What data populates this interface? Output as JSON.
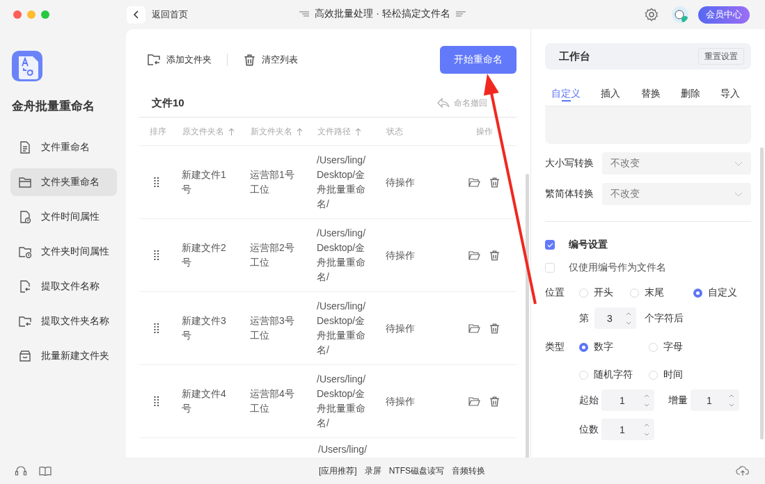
{
  "window": {
    "back_label": "返回首页",
    "title": "高效批量处理 · 轻松搞定文件名",
    "member_button": "会员中心"
  },
  "sidebar": {
    "app_name": "金舟批量重命名",
    "items": [
      {
        "label": "文件重命名",
        "kind": "file",
        "selected": false
      },
      {
        "label": "文件夹重命名",
        "kind": "folder",
        "selected": true
      },
      {
        "label": "文件时间属性",
        "kind": "fileclock",
        "selected": false
      },
      {
        "label": "文件夹时间属性",
        "kind": "folderclock",
        "selected": false
      },
      {
        "label": "提取文件名称",
        "kind": "fileextract",
        "selected": false
      },
      {
        "label": "提取文件夹名称",
        "kind": "folderextract",
        "selected": false
      },
      {
        "label": "批量新建文件夹",
        "kind": "box",
        "selected": false
      }
    ]
  },
  "toolbar": {
    "add_folder": "添加文件夹",
    "clear_list": "清空列表",
    "start_button": "开始重命名"
  },
  "table": {
    "title": "文件10",
    "undo": "命名撤回",
    "columns": [
      {
        "label": "排序",
        "sortable": false
      },
      {
        "label": "原文件夹名",
        "sortable": true
      },
      {
        "label": "新文件夹名",
        "sortable": true
      },
      {
        "label": "文件路径",
        "sortable": true
      },
      {
        "label": "状态",
        "sortable": false
      },
      {
        "label": "操作",
        "sortable": false
      }
    ],
    "rows": [
      {
        "original": "新建文件1号",
        "new_name": "运营部1号工位",
        "path": "/Users/ling/Desktop/金舟批量重命名/",
        "status": "待操作"
      },
      {
        "original": "新建文件2号",
        "new_name": "运营部2号工位",
        "path": "/Users/ling/Desktop/金舟批量重命名/",
        "status": "待操作"
      },
      {
        "original": "新建文件3号",
        "new_name": "运营部3号工位",
        "path": "/Users/ling/Desktop/金舟批量重命名/",
        "status": "待操作"
      },
      {
        "original": "新建文件4号",
        "new_name": "运营部4号工位",
        "path": "/Users/ling/Desktop/金舟批量重命名/",
        "status": "待操作"
      }
    ],
    "partial_row": {
      "path": "/Users/ling/"
    }
  },
  "panel": {
    "title": "工作台",
    "reset_button": "重置设置",
    "tabs": [
      {
        "label": "自定义",
        "selected": true
      },
      {
        "label": "插入",
        "selected": false
      },
      {
        "label": "替换",
        "selected": false
      },
      {
        "label": "删除",
        "selected": false
      },
      {
        "label": "导入",
        "selected": false
      }
    ],
    "selects": [
      {
        "label": "大小写转换",
        "value": "不改变"
      },
      {
        "label": "繁简体转换",
        "value": "不改变"
      }
    ],
    "checks": [
      {
        "label": "编号设置",
        "checked": true
      },
      {
        "label": "仅使用编号作为文件名",
        "checked": false
      }
    ],
    "position": {
      "label": "位置",
      "options": [
        {
          "label": "开头",
          "selected": false
        },
        {
          "label": "末尾",
          "selected": false
        },
        {
          "label": "自定义",
          "selected": true
        }
      ],
      "prefix": "第",
      "value": "3",
      "suffix": "个字符后"
    },
    "type": {
      "label": "类型",
      "options": [
        {
          "label": "数字",
          "selected": true
        },
        {
          "label": "字母",
          "selected": false
        },
        {
          "label": "随机字符",
          "selected": false
        },
        {
          "label": "时间",
          "selected": false
        }
      ]
    },
    "start": {
      "label": "起始",
      "value": "1"
    },
    "step": {
      "label": "增量",
      "value": "1"
    },
    "digits": {
      "label": "位数",
      "value": "1"
    }
  },
  "footer": {
    "links": [
      "[应用推荐]",
      "录屏",
      "NTFS磁盘读写",
      "音频转换"
    ]
  }
}
